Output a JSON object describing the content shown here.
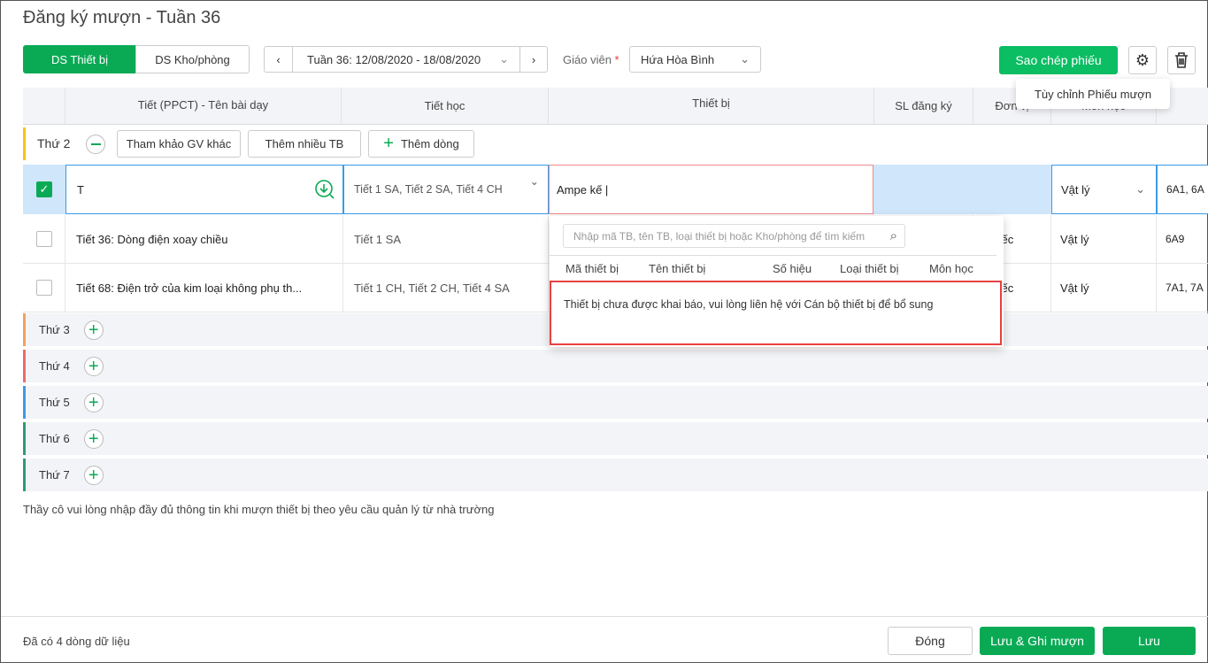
{
  "title": "Đăng ký mượn  - Tuần 36",
  "tabs": {
    "devices": "DS Thiết bị",
    "rooms": "DS Kho/phòng"
  },
  "week": {
    "value": "Tuần 36: 12/08/2020 - 18/08/2020"
  },
  "teacher": {
    "label": "Giáo viên",
    "required": "*",
    "value": "Hứa Hòa Bình"
  },
  "actions": {
    "copy": "Sao chép phiếu",
    "tooltip": "Tùy chỉnh Phiếu mượn"
  },
  "columns": [
    "Tiết (PPCT) -  Tên bài dạy",
    "Tiết học",
    "Thiết bị",
    "SL đăng ký",
    "Đơn vị",
    "Môn học"
  ],
  "day_buttons": {
    "ref": "Tham khảo GV khác",
    "multi": "Thêm nhiều TB",
    "add_row": "Thêm dòng"
  },
  "days": [
    "Thứ 2",
    "Thứ 3",
    "Thứ 4",
    "Thứ 5",
    "Thứ 6",
    "Thứ 7"
  ],
  "rows": [
    {
      "lesson": "T",
      "periods": "Tiết 1 SA, Tiết 2 SA, Tiết 4 CH",
      "device": "Ampe kế |",
      "unit": "",
      "subject": "Vật lý",
      "classes": "6A1, 6A"
    },
    {
      "lesson": "Tiết 36: Dòng điện xoay chiều",
      "periods": "Tiết 1 SA",
      "device": "",
      "unit": "Chiếc",
      "subject": "Vật lý",
      "classes": "6A9"
    },
    {
      "lesson": "Tiết 68: Điện trở của kim loại không phụ th...",
      "periods": "Tiết 1 CH, Tiết 2 CH, Tiết 4 SA",
      "device": "",
      "unit": "Chiếc",
      "subject": "Vật lý",
      "classes": "7A1, 7A"
    }
  ],
  "dropdown": {
    "placeholder": "Nhập mã TB, tên TB, loại thiết bị hoặc Kho/phòng để tìm kiếm",
    "columns": [
      "Mã thiết bị",
      "Tên thiết bị",
      "Số hiệu",
      "Loại thiết bị",
      "Môn học"
    ],
    "empty": "Thiết bị chưa được khai báo, vui lòng liên hệ với Cán bộ thiết bị để bổ sung"
  },
  "note": "Thầy cô vui lòng nhập đầy đủ thông tin khi mượn thiết bị theo yêu cầu quản lý từ nhà trường",
  "footer": {
    "count": "Đã có 4 dòng dữ liệu",
    "close": "Đóng",
    "save_borrow": "Lưu & Ghi mượn",
    "save": "Lưu"
  }
}
